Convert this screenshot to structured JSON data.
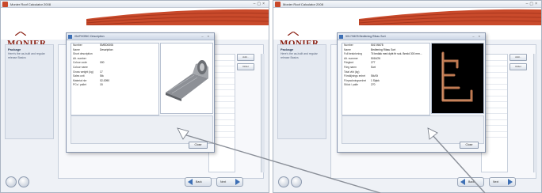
{
  "colors": {
    "brand": "#8a1f12",
    "roof_tile": "#c94a2b",
    "accent_blue": "#3d6fb5",
    "arrow_gray": "#9ea8b6"
  },
  "left_window": {
    "title": "Monier Roof Calculator 2008",
    "brand": "MONIER",
    "sidebar": {
      "heading": "Package",
      "text": "Here's the as-built and regular release Basics"
    },
    "dialog": {
      "title": "ISAPHOBIC Description",
      "properties": [
        {
          "key": "Number",
          "value": "SMED0006"
        },
        {
          "key": "Name",
          "value": "Description"
        },
        {
          "key": "Short description",
          "value": ""
        },
        {
          "key": "Alt. number",
          "value": ""
        },
        {
          "key": "Colour code",
          "value": "000"
        },
        {
          "key": "Colour name",
          "value": ""
        },
        {
          "key": "Gross weight (kg)",
          "value": "17"
        },
        {
          "key": "Sales unit",
          "value": "Stk"
        },
        {
          "key": "Material nbr",
          "value": "02-0090"
        },
        {
          "key": "PCs / pallet",
          "value": "15"
        }
      ],
      "close_label": "Close"
    },
    "side_buttons": [
      "Add...",
      "Order"
    ],
    "footer": {
      "back_label": "Back",
      "next_label": "Next"
    }
  },
  "right_window": {
    "title": "Monier Roof Calculator 2008",
    "brand": "MONIER",
    "sidebar": {
      "heading": "Package",
      "text": "Here's the as-built and regular release Basics"
    },
    "dialog": {
      "title": "5017/6678 Bedlening Ribau Sort",
      "properties": [
        {
          "key": "Number",
          "value": "5017/6678"
        },
        {
          "key": "Name",
          "value": "Bedlening Ribau Sort"
        },
        {
          "key": "Full beskrivning",
          "value": "Til bedlak med dybt ftr sok. Bredd 300 mm..."
        },
        {
          "key": "Alt. nummer",
          "value": "5016/26"
        },
        {
          "key": "Färgkod",
          "value": "277"
        },
        {
          "key": "Färg namn",
          "value": "Sort"
        },
        {
          "key": "Total vikt (kg)",
          "value": ""
        },
        {
          "key": "Försäljnings enhet",
          "value": "Stk/St"
        },
        {
          "key": "Förpackningsenhet",
          "value": "1 Stykk"
        },
        {
          "key": "Stück / palle",
          "value": "270"
        }
      ],
      "close_label": "Close"
    },
    "side_buttons": [
      "Add...",
      "Order"
    ],
    "footer": {
      "back_label": "Back",
      "next_label": "Next"
    }
  }
}
